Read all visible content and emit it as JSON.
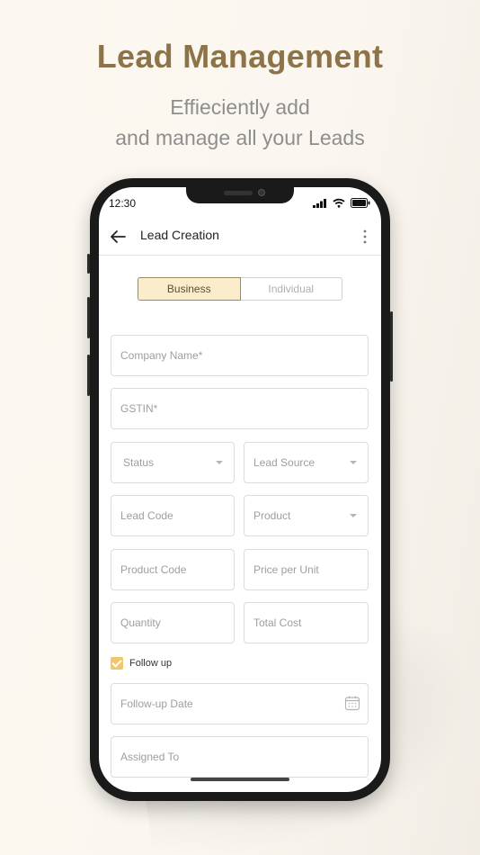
{
  "promo": {
    "headline": "Lead Management",
    "sub_line1": "Effieciently add",
    "sub_line2": "and manage all your Leads"
  },
  "status_bar": {
    "time": "12:30"
  },
  "appbar": {
    "title": "Lead Creation"
  },
  "segment": {
    "business": "Business",
    "individual": "Individual",
    "selected": "Business"
  },
  "fields": {
    "company_name": "Company Name*",
    "gstin": "GSTIN*",
    "status": "Status",
    "lead_source": "Lead Source",
    "lead_code": "Lead Code",
    "product": "Product",
    "product_code": "Product Code",
    "price_per_unit": "Price per Unit",
    "quantity": "Quantity",
    "total_cost": "Total Cost",
    "follow_up_date": "Follow-up Date",
    "assigned_to": "Assigned To"
  },
  "follow_up": {
    "label": "Follow up",
    "checked": true
  },
  "colors": {
    "accent": "#f2c66d",
    "headline": "#8c7448",
    "active_segment_bg": "#fbeccb"
  }
}
